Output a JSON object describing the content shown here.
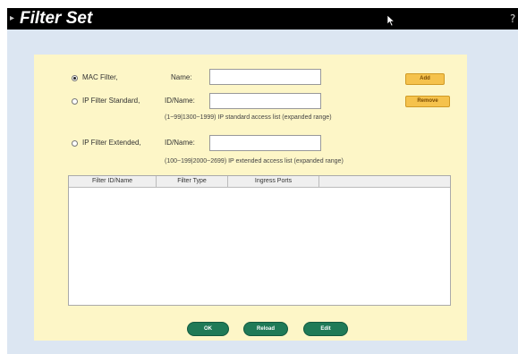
{
  "header": {
    "title": "Filter Set"
  },
  "filters": {
    "mac": {
      "label": "MAC Filter,",
      "name_label": "Name:",
      "name_value": "",
      "selected": true
    },
    "ip_standard": {
      "label": "IP Filter Standard,",
      "id_label": "ID/Name:",
      "id_value": "",
      "hint": "(1~99|1300~1999) IP standard access list (expanded range)"
    },
    "ip_extended": {
      "label": "IP Filter Extended,",
      "id_label": "ID/Name:",
      "id_value": "",
      "hint": "(100~199|2000~2699) IP extended access list (expanded range)"
    }
  },
  "actions": {
    "add": "Add",
    "remove": "Remove"
  },
  "table": {
    "columns": [
      "Filter ID/Name",
      "Filter Type",
      "Ingress Ports"
    ]
  },
  "footer": {
    "ok": "OK",
    "reload": "Reload",
    "edit": "Edit"
  },
  "colors": {
    "title_bar": "#000000",
    "panel_bg": "#fdf6c7",
    "outer_bg": "#dce6f2",
    "button_yellow": "#f5c24c",
    "button_green": "#1f7a57"
  },
  "icons": {
    "cursor": "mouse-pointer-icon",
    "corner": "help-icon",
    "title_bullet": "bullet-icon"
  }
}
